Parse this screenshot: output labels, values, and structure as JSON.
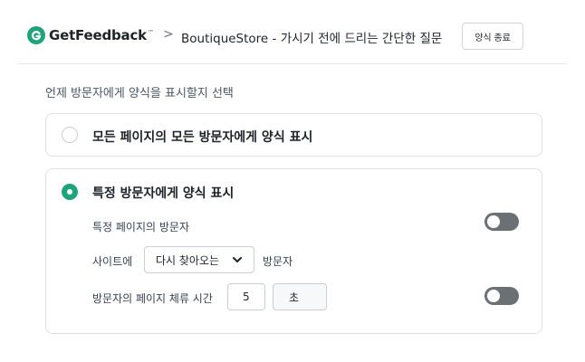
{
  "header": {
    "brand": "GetFeedback",
    "brand_tm": "™",
    "separator": ">",
    "breadcrumb": "BoutiqueStore - 가시기 전에 드리는 간단한 질문",
    "exit_button": "양식 종료"
  },
  "question": "언제 방문자에게 양식을 표시할지 선택",
  "options": [
    {
      "label": "모든 페이지의 모든 방문자에게 양식 표시",
      "selected": false
    },
    {
      "label": "특정 방문자에게 양식 표시",
      "selected": true
    }
  ],
  "specific": {
    "specific_pages_label": "특정 페이지의 방문자",
    "specific_pages_enabled": false,
    "site_prefix": "사이트에",
    "visitor_type_value": "다시 찾아오는",
    "site_suffix": "방문자",
    "time_label": "방문자의 페이지 체류 시간",
    "time_value": "5",
    "time_unit": "초",
    "time_enabled": false
  },
  "colors": {
    "brand": "#1fa37a",
    "toggle_off": "#6b7075",
    "border": "#dde1e6"
  },
  "icons": [
    "getfeedback-logo-icon",
    "chevron-right-icon",
    "chevron-down-icon"
  ]
}
